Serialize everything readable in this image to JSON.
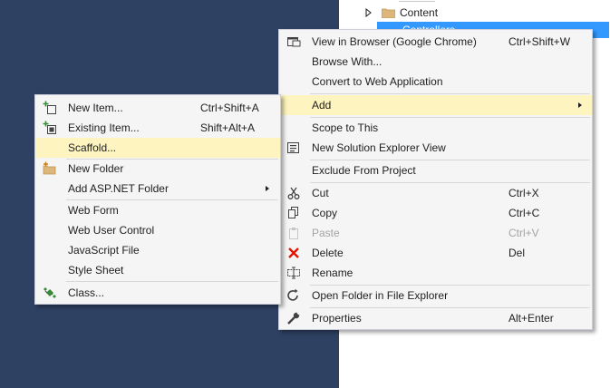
{
  "solution_explorer": {
    "items": [
      {
        "label": "Content",
        "expanded": false,
        "selected": false
      },
      {
        "label": "Controllers",
        "expanded": true,
        "selected": true
      }
    ]
  },
  "context_menu": [
    {
      "label": "View in Browser (Google Chrome)",
      "shortcut": "Ctrl+Shift+W",
      "icon": "view-in-browser-icon"
    },
    {
      "label": "Browse With...",
      "shortcut": "",
      "icon": ""
    },
    {
      "label": "Convert to Web Application",
      "shortcut": "",
      "icon": ""
    },
    {
      "label": "Add",
      "shortcut": "",
      "icon": "",
      "submenu": true,
      "highlighted": true
    },
    {
      "label": "Scope to This",
      "shortcut": "",
      "icon": ""
    },
    {
      "label": "New Solution Explorer View",
      "shortcut": "",
      "icon": "new-solution-explorer-view-icon"
    },
    {
      "label": "Exclude From Project",
      "shortcut": "",
      "icon": ""
    },
    {
      "label": "Cut",
      "shortcut": "Ctrl+X",
      "icon": "cut-icon"
    },
    {
      "label": "Copy",
      "shortcut": "Ctrl+C",
      "icon": "copy-icon"
    },
    {
      "label": "Paste",
      "shortcut": "Ctrl+V",
      "icon": "paste-icon",
      "disabled": true
    },
    {
      "label": "Delete",
      "shortcut": "Del",
      "icon": "delete-icon"
    },
    {
      "label": "Rename",
      "shortcut": "",
      "icon": "rename-icon"
    },
    {
      "label": "Open Folder in File Explorer",
      "shortcut": "",
      "icon": "open-folder-icon"
    },
    {
      "label": "Properties",
      "shortcut": "Alt+Enter",
      "icon": "wrench-icon"
    }
  ],
  "add_submenu": [
    {
      "label": "New Item...",
      "shortcut": "Ctrl+Shift+A",
      "icon": "new-item-icon"
    },
    {
      "label": "Existing Item...",
      "shortcut": "Shift+Alt+A",
      "icon": "existing-item-icon"
    },
    {
      "label": "Scaffold...",
      "shortcut": "",
      "icon": "",
      "highlighted": true
    },
    {
      "label": "New Folder",
      "shortcut": "",
      "icon": "new-folder-icon"
    },
    {
      "label": "Add ASP.NET Folder",
      "shortcut": "",
      "icon": "",
      "submenu": true
    },
    {
      "label": "Web Form",
      "shortcut": "",
      "icon": ""
    },
    {
      "label": "Web User Control",
      "shortcut": "",
      "icon": ""
    },
    {
      "label": "JavaScript File",
      "shortcut": "",
      "icon": ""
    },
    {
      "label": "Style Sheet",
      "shortcut": "",
      "icon": ""
    },
    {
      "label": "Class...",
      "shortcut": "",
      "icon": "class-icon"
    }
  ],
  "colors": {
    "background": "#2e4162",
    "menu_background": "#f5f5f5",
    "menu_border": "#cccedb",
    "highlight": "#fdf4bf",
    "selection": "#3399ff",
    "disabled_text": "#a2a4a5"
  }
}
